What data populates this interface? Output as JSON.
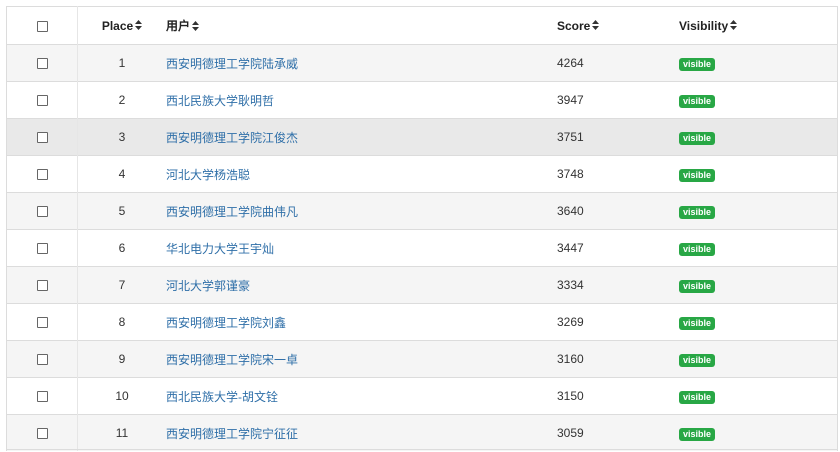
{
  "header": {
    "place_label": "Place",
    "user_label": "用户",
    "score_label": "Score",
    "visibility_label": "Visibility"
  },
  "rows": [
    {
      "place": "1",
      "user": "西安明德理工学院陆承威",
      "score": "4264",
      "visibility": "visible"
    },
    {
      "place": "2",
      "user": "西北民族大学耿明哲",
      "score": "3947",
      "visibility": "visible"
    },
    {
      "place": "3",
      "user": "西安明德理工学院江俊杰",
      "score": "3751",
      "visibility": "visible"
    },
    {
      "place": "4",
      "user": "河北大学杨浩聪",
      "score": "3748",
      "visibility": "visible"
    },
    {
      "place": "5",
      "user": "西安明德理工学院曲伟凡",
      "score": "3640",
      "visibility": "visible"
    },
    {
      "place": "6",
      "user": "华北电力大学王宇灿",
      "score": "3447",
      "visibility": "visible"
    },
    {
      "place": "7",
      "user": "河北大学郭谨豪",
      "score": "3334",
      "visibility": "visible"
    },
    {
      "place": "8",
      "user": "西安明德理工学院刘鑫",
      "score": "3269",
      "visibility": "visible"
    },
    {
      "place": "9",
      "user": "西安明德理工学院宋一卓",
      "score": "3160",
      "visibility": "visible"
    },
    {
      "place": "10",
      "user": "西北民族大学-胡文铨",
      "score": "3150",
      "visibility": "visible"
    },
    {
      "place": "11",
      "user": "西安明德理工学院宁征征",
      "score": "3059",
      "visibility": "visible"
    }
  ],
  "colors": {
    "link": "#2f6fa8",
    "badge_green": "#28a745",
    "stripe": "#f5f5f5",
    "highlight": "#e9e9e9"
  },
  "icons": {
    "checkbox": "checkbox-icon",
    "sort": "sort-icon"
  }
}
